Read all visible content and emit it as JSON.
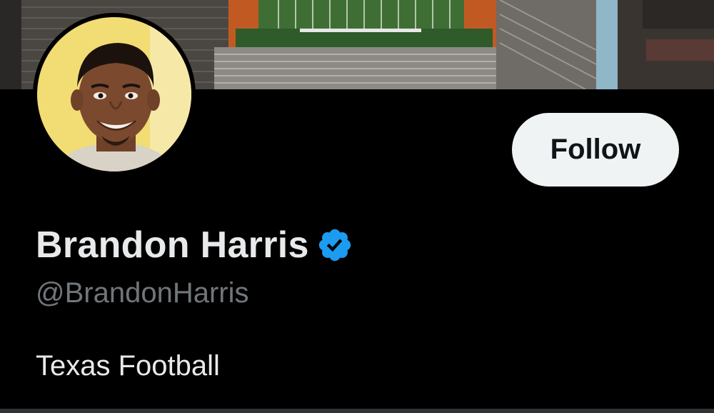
{
  "profile": {
    "display_name": "Brandon Harris",
    "handle": "@BrandonHarris",
    "bio": "Texas Football",
    "verified": true
  },
  "actions": {
    "follow_label": "Follow"
  },
  "banner": {
    "description_icon": "stadium-aerial-image"
  },
  "colors": {
    "background": "#000000",
    "text_primary": "#e7e9ea",
    "text_secondary": "#71767b",
    "verified_blue": "#1d9bf0",
    "follow_bg": "#eff3f4"
  }
}
